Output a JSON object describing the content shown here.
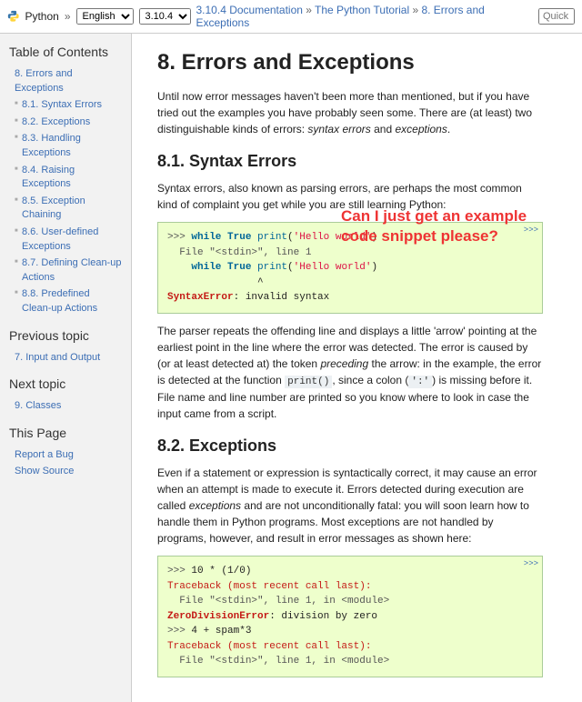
{
  "topbar": {
    "logo_label": "Python",
    "lang_selected": "English",
    "version_selected": "3.10.4",
    "crumb1": "3.10.4 Documentation",
    "crumb2": "The Python Tutorial",
    "crumb3": "8. Errors and Exceptions",
    "separator": " » ",
    "search_placeholder": "Quick s"
  },
  "sidebar": {
    "toc_title": "Table of Contents",
    "toc_items": [
      "8. Errors and Exceptions",
      "8.1. Syntax Errors",
      "8.2. Exceptions",
      "8.3. Handling Exceptions",
      "8.4. Raising Exceptions",
      "8.5. Exception Chaining",
      "8.6. User-defined Exceptions",
      "8.7. Defining Clean-up Actions",
      "8.8. Predefined Clean-up Actions"
    ],
    "prev_title": "Previous topic",
    "prev_link": "7. Input and Output",
    "next_title": "Next topic",
    "next_link": "9. Classes",
    "thispage_title": "This Page",
    "thispage_links": [
      "Report a Bug",
      "Show Source"
    ]
  },
  "main": {
    "h1": "8. Errors and Exceptions",
    "p1a": "Until now error messages haven't been more than mentioned, but if you have tried out the examples you have probably seen some. There are (at least) two distinguishable kinds of errors: ",
    "p1b": "syntax errors",
    "p1c": " and ",
    "p1d": "exceptions",
    "p1e": ".",
    "h2a": "8.1. Syntax Errors",
    "p2": "Syntax errors, also known as parsing errors, are perhaps the most common kind of complaint you get while you are still learning Python:",
    "code1": {
      "hide": ">>>",
      "l1_prompt": ">>> ",
      "l1_kw": "while",
      "l1_true": " True ",
      "l1_print": "print",
      "l1_paren": "(",
      "l1_str": "'Hello world'",
      "l1_close": ")",
      "l2": "  File \"<stdin>\", line 1",
      "l3a": "    while True ",
      "l3_print": "print",
      "l3b": "(",
      "l3_str": "'Hello world'",
      "l3c": ")",
      "l4": "               ^",
      "l5_err": "SyntaxError",
      "l5_rest": ": invalid syntax"
    },
    "p3a": "The parser repeats the offending line and displays a little 'arrow' pointing at the earliest point in the line where the error was detected. The error is caused by (or at least detected at) the token ",
    "p3b": "preceding",
    "p3c": " the arrow: in the example, the error is detected at the function ",
    "p3_code1": "print()",
    "p3d": ", since a colon (",
    "p3_code2": "':'",
    "p3e": ") is missing before it. File name and line number are printed so you know where to look in case the input came from a script.",
    "h2b": "8.2. Exceptions",
    "p4a": "Even if a statement or expression is syntactically correct, it may cause an error when an attempt is made to execute it. Errors detected during execution are called ",
    "p4b": "exceptions",
    "p4c": " and are not unconditionally fatal: you will soon learn how to handle them in Python programs. Most exceptions are not handled by programs, however, and result in error messages as shown here:",
    "code2": {
      "hide": ">>>",
      "l1_prompt": ">>> ",
      "l1_expr": "10 * (1/0)",
      "l2": "Traceback (most recent call last):",
      "l3": "  File \"<stdin>\", line 1, in <module>",
      "l4_err": "ZeroDivisionError",
      "l4_rest": ": division by zero",
      "l5_prompt": ">>> ",
      "l5_expr": "4 + spam*3",
      "l6": "Traceback (most recent call last):",
      "l7": "  File \"<stdin>\", line 1, in <module>"
    }
  },
  "annotation": "Can I just get an example code snippet please?"
}
